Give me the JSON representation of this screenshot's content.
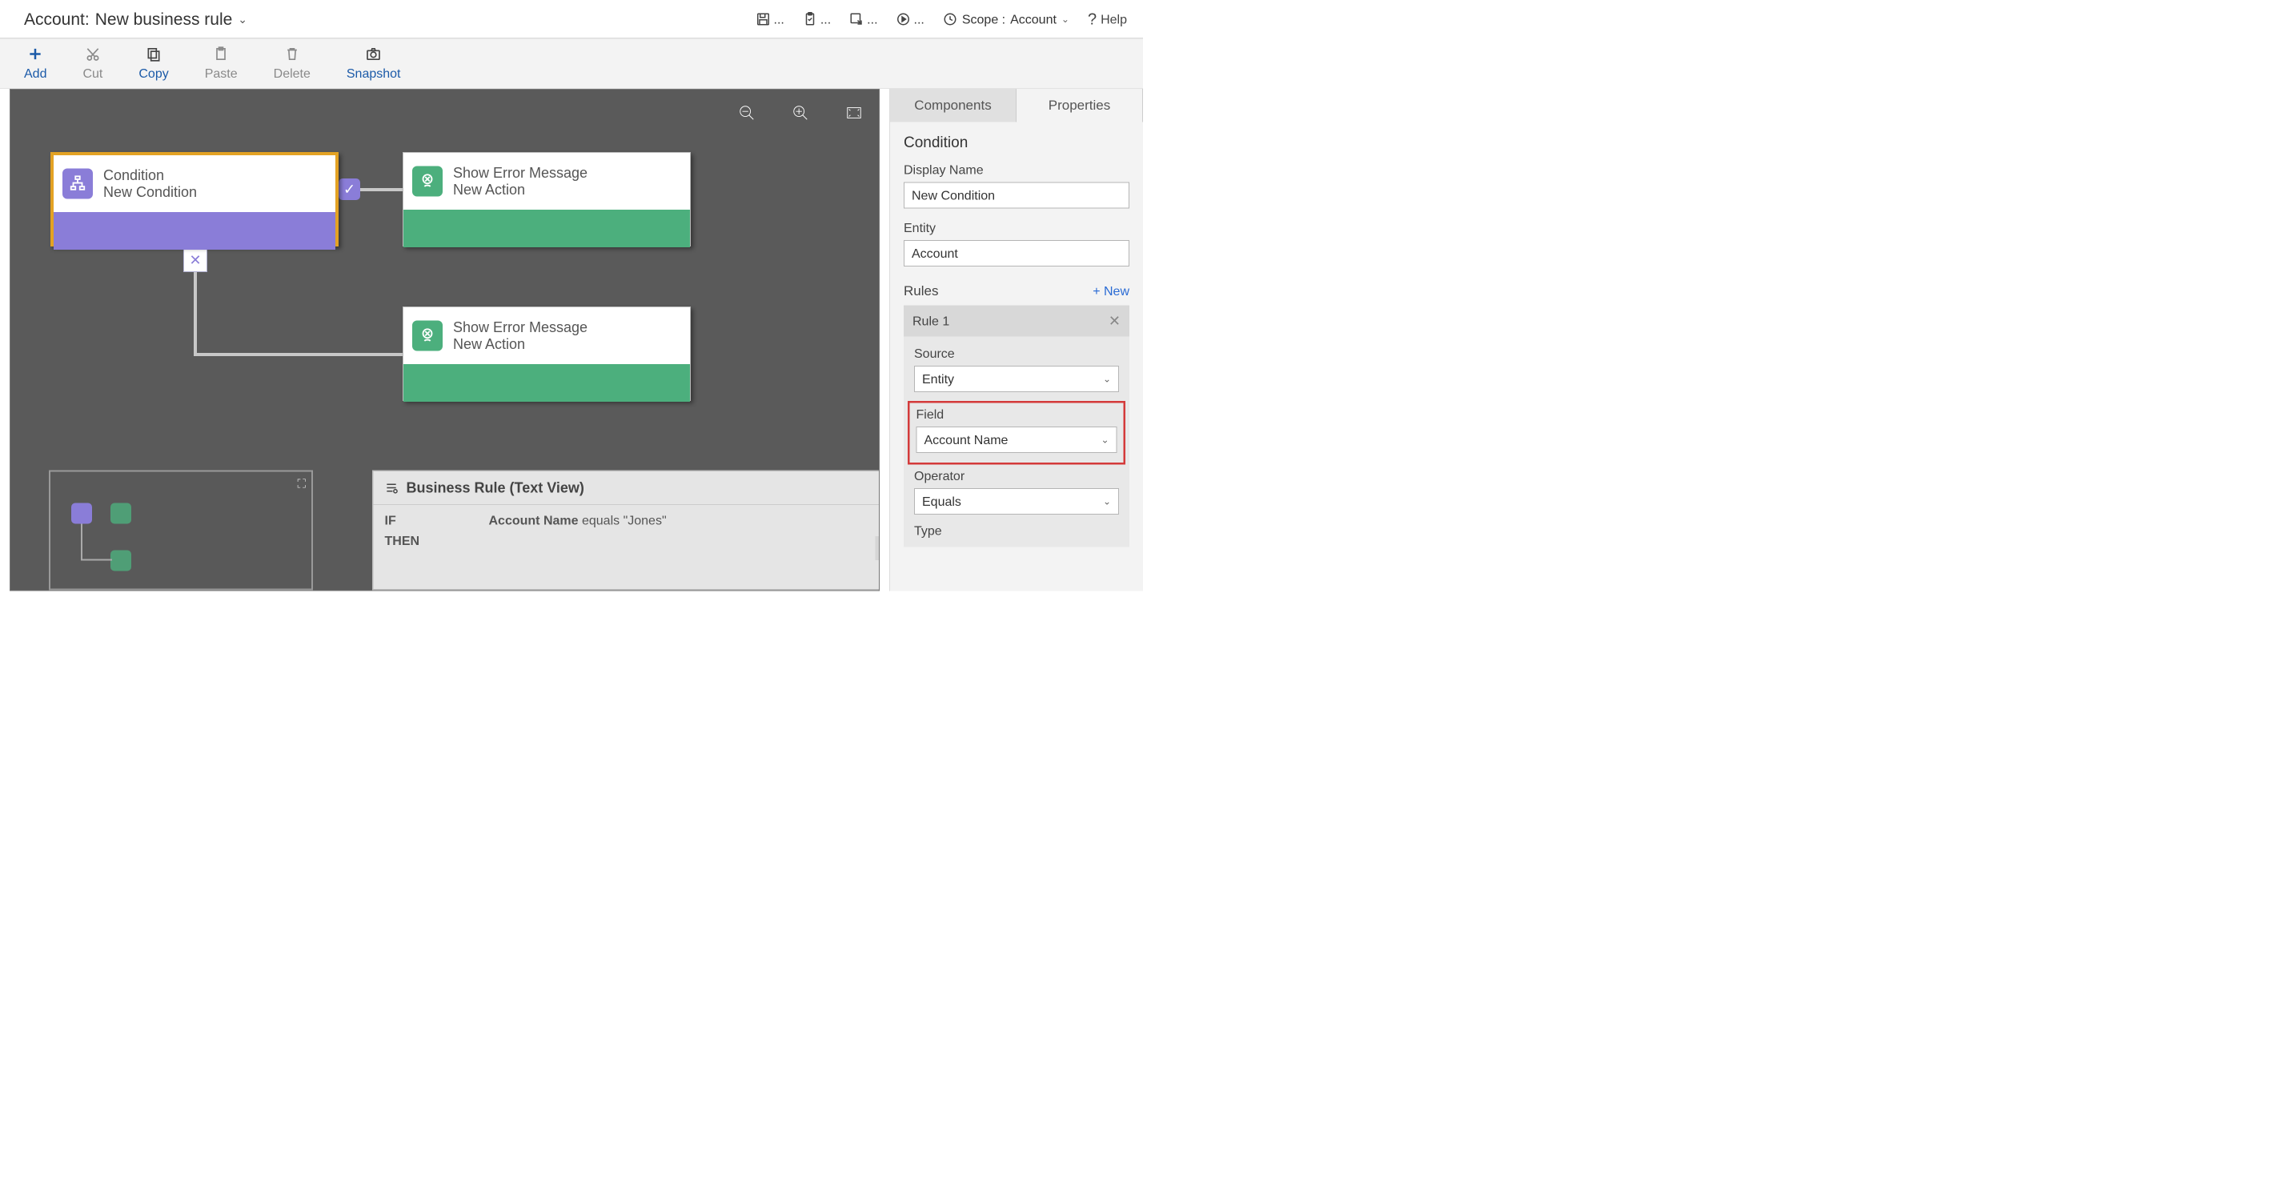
{
  "header": {
    "title_prefix": "Account:",
    "title": "New business rule",
    "scope_label": "Scope :",
    "scope_value": "Account",
    "help": "Help"
  },
  "toolbar": {
    "add": "Add",
    "cut": "Cut",
    "copy": "Copy",
    "paste": "Paste",
    "delete": "Delete",
    "snapshot": "Snapshot"
  },
  "nodes": {
    "condition": {
      "line1": "Condition",
      "line2": "New Condition"
    },
    "action1": {
      "line1": "Show Error Message",
      "line2": "New Action"
    },
    "action2": {
      "line1": "Show Error Message",
      "line2": "New Action"
    }
  },
  "textview": {
    "title": "Business Rule (Text View)",
    "if": "IF",
    "then": "THEN",
    "if_text_field": "Account Name",
    "if_text_rest": " equals \"Jones\""
  },
  "panel": {
    "tab_components": "Components",
    "tab_properties": "Properties",
    "section": "Condition",
    "display_name_label": "Display Name",
    "display_name_value": "New Condition",
    "entity_label": "Entity",
    "entity_value": "Account",
    "rules_label": "Rules",
    "rules_new": "+  New",
    "rule1": "Rule 1",
    "source_label": "Source",
    "source_value": "Entity",
    "field_label": "Field",
    "field_value": "Account Name",
    "operator_label": "Operator",
    "operator_value": "Equals",
    "type_label": "Type"
  }
}
